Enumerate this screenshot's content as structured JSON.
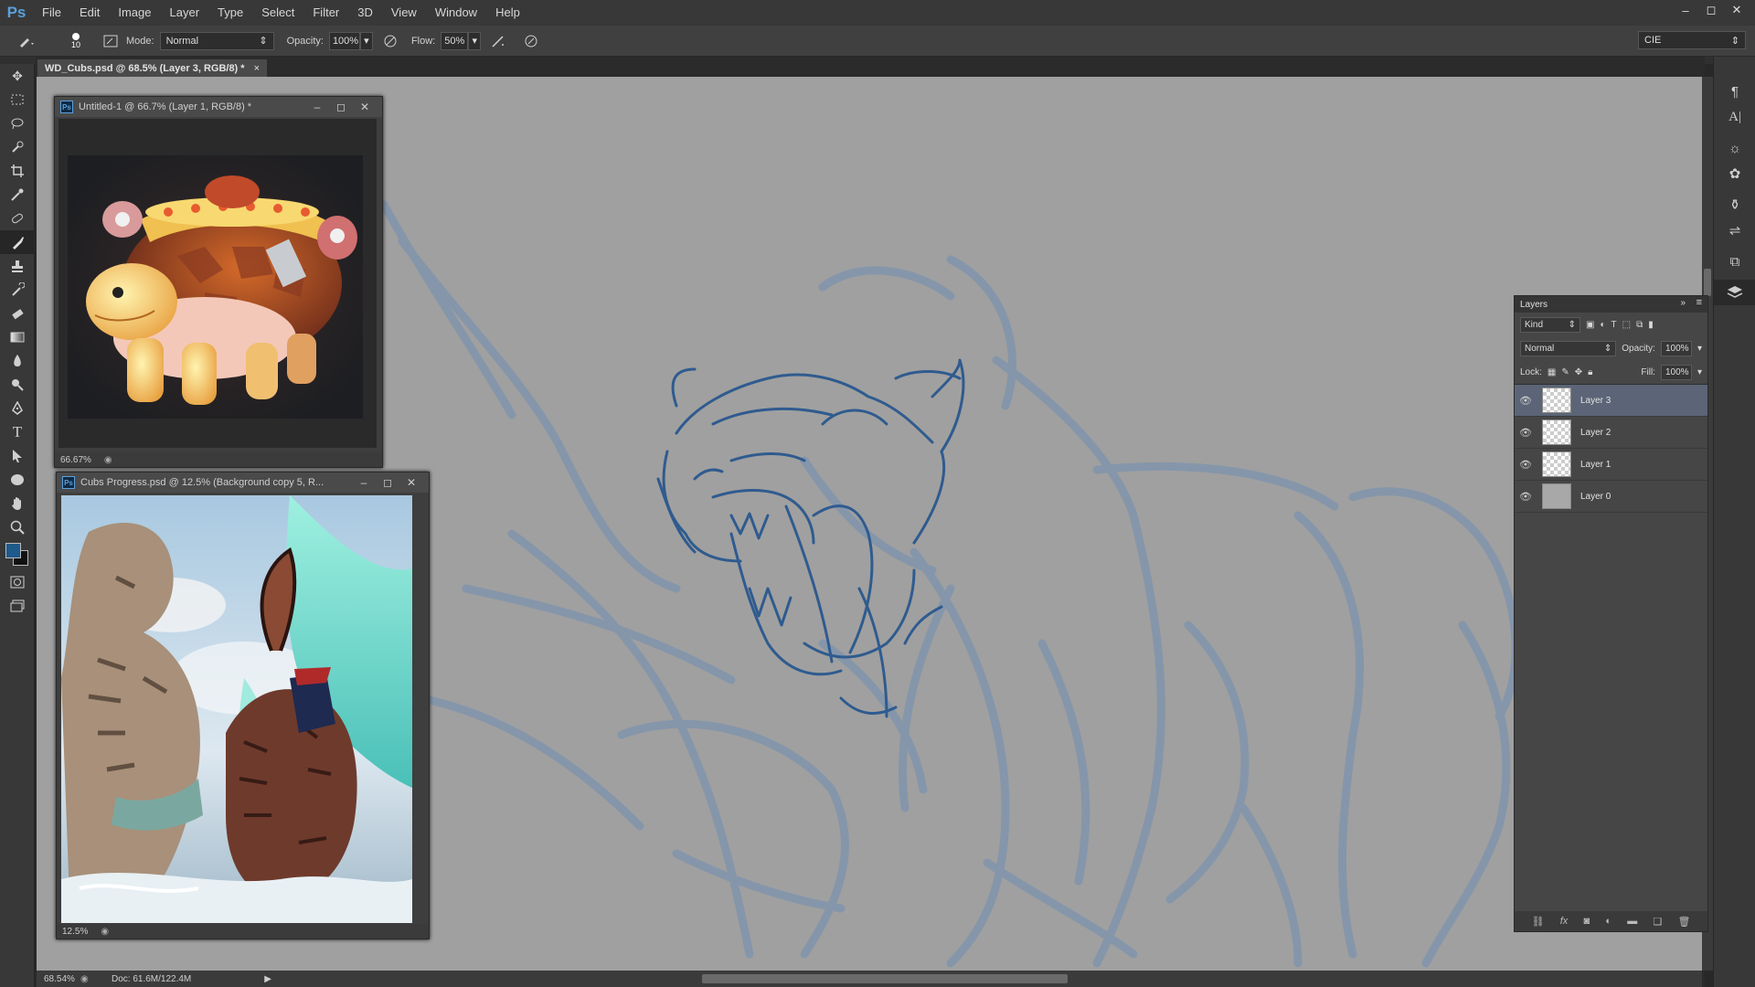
{
  "app": {
    "logo": "Ps",
    "menu": [
      "File",
      "Edit",
      "Image",
      "Layer",
      "Type",
      "Select",
      "Filter",
      "3D",
      "View",
      "Window",
      "Help"
    ],
    "window_controls": [
      "–",
      "◻",
      "✕"
    ]
  },
  "options_bar": {
    "brush_size": "10",
    "mode_label": "Mode:",
    "mode_value": "Normal",
    "opacity_label": "Opacity:",
    "opacity_value": "100%",
    "flow_label": "Flow:",
    "flow_value": "50%",
    "workspace_value": "CIE"
  },
  "document": {
    "tab_title": "WD_Cubs.psd @ 68.5% (Layer 3, RGB/8) *",
    "tab_close": "×",
    "zoom": "68.54%",
    "doc_size": "Doc: 61.6M/122.4M"
  },
  "float_windows": [
    {
      "title": "Untitled-1 @ 66.7% (Layer 1, RGB/8) *",
      "zoom": "66.67%"
    },
    {
      "title": "Cubs Progress.psd @ 12.5% (Background copy 5, R...",
      "zoom": "12.5%"
    }
  ],
  "layers_panel": {
    "title": "Layers",
    "filter_kind": "Kind",
    "blend_mode": "Normal",
    "opacity_label": "Opacity:",
    "opacity_value": "100%",
    "lock_label": "Lock:",
    "fill_label": "Fill:",
    "fill_value": "100%",
    "layers": [
      {
        "name": "Layer 3",
        "selected": true
      },
      {
        "name": "Layer 2",
        "selected": false
      },
      {
        "name": "Layer 1",
        "selected": false
      },
      {
        "name": "Layer 0",
        "selected": false
      }
    ]
  },
  "colors": {
    "foreground": "#1e5a8c",
    "background": "#111111",
    "accent": "#5aa0dc",
    "sketch_line": "#6e88a8",
    "sketch_dark": "#2e5a8e"
  }
}
